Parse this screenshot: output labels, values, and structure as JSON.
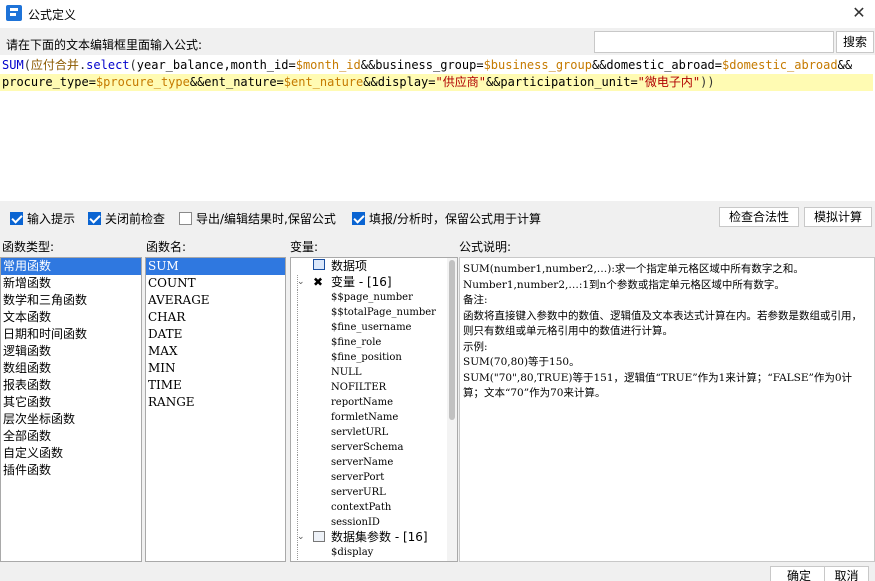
{
  "window": {
    "title": "公式定义",
    "close_glyph": "✕"
  },
  "prompt": "请在下面的文本编辑框里面输入公式:",
  "search": {
    "value": "",
    "button": "搜索"
  },
  "editor": {
    "line1": [
      {
        "t": "SUM",
        "c": "fn"
      },
      {
        "t": "(",
        "c": "p"
      },
      {
        "t": "应付合并",
        "c": "tbl"
      },
      {
        "t": ".",
        "c": "p"
      },
      {
        "t": "select",
        "c": "fn"
      },
      {
        "t": "(",
        "c": "p"
      },
      {
        "t": "year_balance,month_id=",
        "c": "id"
      },
      {
        "t": "$month_id",
        "c": "var"
      },
      {
        "t": "&&business_group=",
        "c": "id"
      },
      {
        "t": "$business_group",
        "c": "var"
      },
      {
        "t": "&&domestic_abroad=",
        "c": "id"
      },
      {
        "t": "$domestic_abroad",
        "c": "var"
      },
      {
        "t": "&&",
        "c": "id"
      }
    ],
    "line2": [
      {
        "t": "procure_type=",
        "c": "id"
      },
      {
        "t": "$procure_type",
        "c": "var"
      },
      {
        "t": "&&ent_nature=",
        "c": "id"
      },
      {
        "t": "$ent_nature",
        "c": "var"
      },
      {
        "t": "&&display=",
        "c": "id"
      },
      {
        "t": "\"供应商\"",
        "c": "str"
      },
      {
        "t": "&&participation_unit=",
        "c": "id"
      },
      {
        "t": "\"微电子内\"",
        "c": "str"
      },
      {
        "t": "))",
        "c": "p"
      }
    ]
  },
  "options": {
    "input_hint": {
      "label": "输入提示",
      "checked": true
    },
    "check_before_close": {
      "label": "关闭前检查",
      "checked": true
    },
    "keep_formula_export": {
      "label": "导出/编辑结果时,保留公式",
      "checked": false
    },
    "keep_formula_fill": {
      "label": "填报/分析时，保留公式用于计算",
      "checked": true
    }
  },
  "buttons": {
    "check_validity": "检查合法性",
    "simulate": "模拟计算",
    "ok": "确定",
    "cancel": "取消"
  },
  "labels": {
    "func_type": "函数类型:",
    "func_name": "函数名:",
    "variable": "变量:",
    "desc": "公式说明:"
  },
  "func_types": [
    "常用函数",
    "新增函数",
    "数学和三角函数",
    "文本函数",
    "日期和时间函数",
    "逻辑函数",
    "数组函数",
    "报表函数",
    "其它函数",
    "层次坐标函数",
    "全部函数",
    "自定义函数",
    "插件函数"
  ],
  "func_types_selected": 0,
  "func_names": [
    "SUM",
    "COUNT",
    "AVERAGE",
    "CHAR",
    "DATE",
    "MAX",
    "MIN",
    "TIME",
    "RANGE"
  ],
  "func_names_selected": 0,
  "variables": {
    "data_item": "数据项",
    "var_group": "变量 - [16]",
    "vars": [
      "$$page_number",
      "$$totalPage_number",
      "$fine_username",
      "$fine_role",
      "$fine_position",
      "NULL",
      "NOFILTER",
      "reportName",
      "formletName",
      "servletURL",
      "serverSchema",
      "serverName",
      "serverPort",
      "serverURL",
      "contextPath",
      "sessionID"
    ],
    "dataset_group": "数据集参数 - [16]",
    "dataset_vars": [
      "$display"
    ]
  },
  "description": [
    "SUM(number1,number2,…):求一个指定单元格区域中所有数字之和。",
    "Number1,number2,…:1到n个参数或指定单元格区域中所有数字。",
    "备注:",
    "函数将直接键入参数中的数值、逻辑值及文本表达式计算在内。若参数是数组或引用，则只有数组或单元格引用中的数值进行计算。",
    "示例:",
    "SUM(70,80)等于150。",
    "SUM(\"70\",80,TRUE)等于151，逻辑值“TRUE”作为1来计算；“FALSE”作为0计算；文本“70”作为70来计算。"
  ]
}
